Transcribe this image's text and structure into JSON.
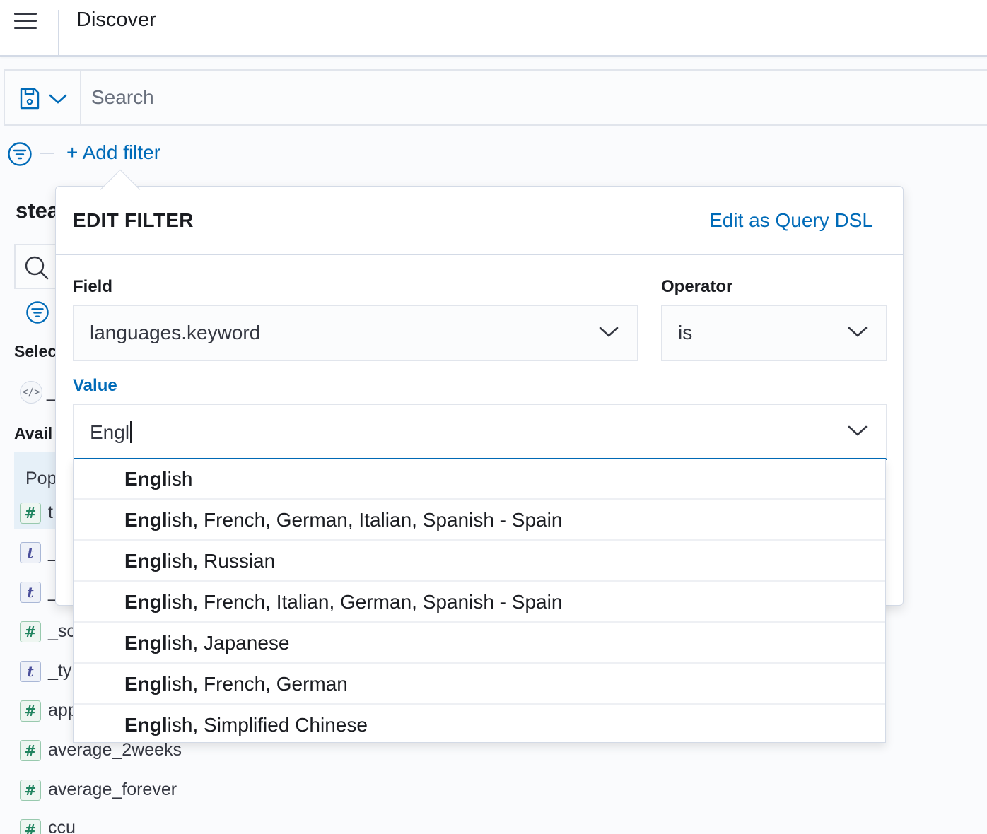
{
  "header": {
    "title": "Discover"
  },
  "query": {
    "placeholder": "Search"
  },
  "filters": {
    "add_label": "+ Add filter"
  },
  "sidebar": {
    "index_title_partial": "stea",
    "selected_heading_partial": "Selec",
    "available_heading_partial": "Avail",
    "popular_label_partial": "Pop",
    "fields": [
      {
        "type": "number",
        "symbol": "#",
        "name": "t"
      },
      {
        "type": "string",
        "symbol": "t",
        "name": "_"
      },
      {
        "type": "string",
        "symbol": "t",
        "name": "_"
      },
      {
        "type": "number",
        "symbol": "#",
        "name": "_sc"
      },
      {
        "type": "string",
        "symbol": "t",
        "name": "_ty"
      },
      {
        "type": "number",
        "symbol": "#",
        "name": "app"
      },
      {
        "type": "number",
        "symbol": "#",
        "name": "average_2weeks"
      },
      {
        "type": "number",
        "symbol": "#",
        "name": "average_forever"
      },
      {
        "type": "number",
        "symbol": "#",
        "name": "ccu"
      }
    ],
    "selected_field_partial": "_"
  },
  "edit_filter": {
    "title": "EDIT FILTER",
    "dsl_link": "Edit as Query DSL",
    "field_label": "Field",
    "field_value": "languages.keyword",
    "operator_label": "Operator",
    "operator_value": "is",
    "value_label": "Value",
    "value_input": "Engl",
    "match_prefix": "Engl",
    "options": [
      {
        "match": "Engl",
        "rest": "ish"
      },
      {
        "match": "Engl",
        "rest": "ish, French, German, Italian, Spanish - Spain"
      },
      {
        "match": "Engl",
        "rest": "ish, Russian"
      },
      {
        "match": "Engl",
        "rest": "ish, French, Italian, German, Spanish - Spain"
      },
      {
        "match": "Engl",
        "rest": "ish, Japanese"
      },
      {
        "match": "Engl",
        "rest": "ish, French, German"
      },
      {
        "match": "Engl",
        "rest": "ish, Simplified Chinese"
      }
    ]
  },
  "colors": {
    "accent": "#006bb8",
    "border": "#d3dae6",
    "text": "#1a1c21"
  }
}
